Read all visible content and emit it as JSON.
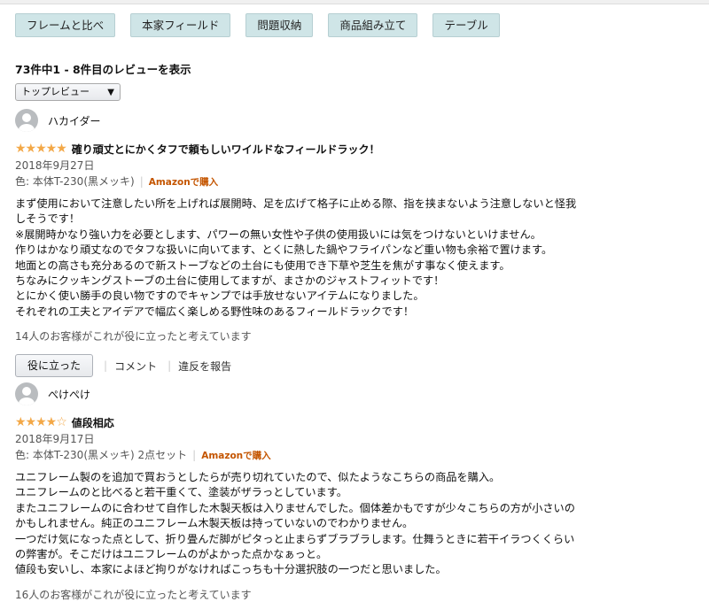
{
  "tabs": [
    "フレームと比べ",
    "本家フィールド",
    "問題収納",
    "商品組み立て",
    "テーブル"
  ],
  "review_count": "73件中1 - 8件目のレビューを表示",
  "sort": {
    "selected": "トップレビュー"
  },
  "reviews": [
    {
      "name": "ハカイダー",
      "stars": "★★★★★",
      "stars_empty": "",
      "title": "確り頑丈とにかくタフで頼もしいワイルドなフィールドラック！",
      "date": "2018年9月27日",
      "variant": "色: 本体T-230(黒メッキ)",
      "verified": "Amazonで購入",
      "lines": [
        "まず使用において注意したい所を上げれば展開時、足を広げて格子に止める際、指を挟まないよう注意しないと怪我",
        "しそうです！",
        "※展開時かなり強い力を必要とします、パワーの無い女性や子供の使用扱いには気をつけないといけません。",
        "作りはかなり頑丈なのでタフな扱いに向いてます、とくに熱した鍋やフライパンなど重い物も余裕で置けます。",
        "地面との高さも充分あるので新ストーブなどの土台にも使用でき下草や芝生を焦がす事なく使えます。",
        "ちなみにクッキングストーブの土台に使用してますが、まさかのジャストフィットです！",
        "とにかく使い勝手の良い物ですのでキャンプでは手放せないアイテムになりました。",
        "それぞれの工夫とアイデアで幅広く楽しめる野性味のあるフィールドラックです！"
      ],
      "helpful": "14人のお客様がこれが役に立ったと考えています",
      "helpful_button": "役に立った",
      "comment": "コメント",
      "report": "違反を報告"
    },
    {
      "name": "ぺけぺけ",
      "stars": "★★★★",
      "stars_empty": "☆",
      "title": "値段相応",
      "date": "2018年9月17日",
      "variant": "色: 本体T-230(黒メッキ) 2点セット",
      "verified": "Amazonで購入",
      "lines": [
        "ユニフレーム製のを追加で買おうとしたらが売り切れていたので、似たようなこちらの商品を購入。",
        "ユニフレームのと比べると若干重くて、塗装がザラっとしています。",
        "またユニフレームのに合わせて自作した木製天板は入りませんでした。個体差かもですが少々こちらの方が小さいの",
        "かもしれません。純正のユニフレーム木製天板は持っていないのでわかりません。",
        "一つだけ気になった点として、折り畳んだ脚がピタっと止まらずブラブラします。仕舞うときに若干イラつくくらい",
        "の弊害が。そこだけはユニフレームのがよかった点かなぁっと。",
        "値段も安いし、本家によほど拘りがなければこっちも十分選択肢の一つだと思いました。"
      ],
      "helpful": "16人のお客様がこれが役に立ったと考えています"
    }
  ]
}
